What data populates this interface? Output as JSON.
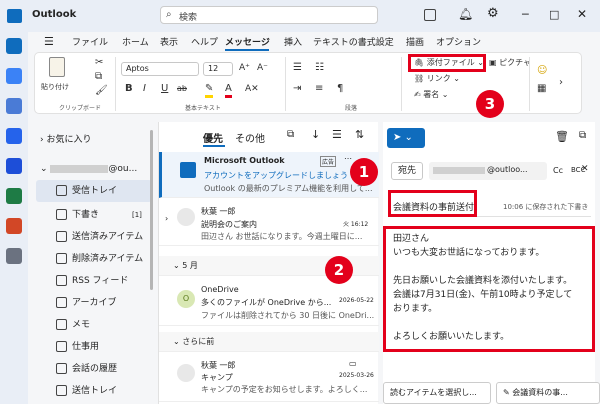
{
  "app": {
    "title": "Outlook"
  },
  "search": {
    "placeholder": "検索"
  },
  "menu": [
    "ファイル",
    "ホーム",
    "表示",
    "ヘルプ",
    "メッセージ",
    "挿入",
    "テキストの書式設定",
    "描画",
    "オプション"
  ],
  "ribbon": {
    "paste": "貼り付け",
    "clipboard": "クリップボード",
    "font": "Aptos",
    "font_size": "12",
    "basic_text": "基本テキスト",
    "paragraph": "段落",
    "attach": "添付ファイル",
    "picture": "ピクチャ",
    "link": "リンク",
    "signature": "署名",
    "bold": "B",
    "italic": "I",
    "underline": "U",
    "strike": "ab"
  },
  "folders": {
    "favorites": "お気に入り",
    "account": "@ou...",
    "items": [
      {
        "label": "受信トレイ"
      },
      {
        "label": "下書き",
        "count": "[1]"
      },
      {
        "label": "送信済みアイテム"
      },
      {
        "label": "削除済みアイテム"
      },
      {
        "label": "RSS フィード"
      },
      {
        "label": "アーカイブ"
      },
      {
        "label": "メモ"
      },
      {
        "label": "仕事用"
      },
      {
        "label": "会話の履歴"
      },
      {
        "label": "送信トレイ"
      }
    ]
  },
  "list": {
    "tab_priority": "優先",
    "tab_other": "その他",
    "ms": {
      "sender": "Microsoft Outlook",
      "ad": "広告",
      "subject": "アカウントをアップグレードしましょう",
      "preview": "Outlook の最新のプレミアム機能を利用して..."
    },
    "m1": {
      "sender": "秋葉 一郎",
      "subject": "説明会のご案内",
      "preview": "田辺さん お世話になります。今週土曜日に...",
      "time": "火 16:12"
    },
    "section_may": "5 月",
    "m2": {
      "avatar": "O",
      "sender": "OneDrive",
      "subject": "多くのファイルが OneDrive から...",
      "preview": "ファイルは削除されてから 30 日後に OneDri...",
      "date": "2026-05-22"
    },
    "section_earlier": "さらに前",
    "m3": {
      "sender": "秋葉 一郎",
      "subject": "キャンプ",
      "preview": "キャンプの予定をお知らせします。よろしく...",
      "date": "2025-03-26"
    }
  },
  "compose": {
    "to_label": "宛先",
    "to_value": "@outloo...",
    "cc": "Cc",
    "bcc": "BCC",
    "subject": "会議資料の事前送付",
    "saved": "10:06 に保存された下書き",
    "body": [
      "田辺さん",
      "いつも大変お世話になっております。",
      "",
      "先日お願いした会議資料を添付いたします。",
      "会議は7月31日(金)、午前10時より予定して",
      "おります。",
      "",
      "よろしくお願いいたします。"
    ]
  },
  "status": {
    "left": "読むアイテムを選択し...",
    "right": "会議資料の事..."
  },
  "callouts": [
    "1",
    "2",
    "3"
  ],
  "colors": {
    "accent": "#0f6cbd",
    "red": "#e3001b"
  }
}
